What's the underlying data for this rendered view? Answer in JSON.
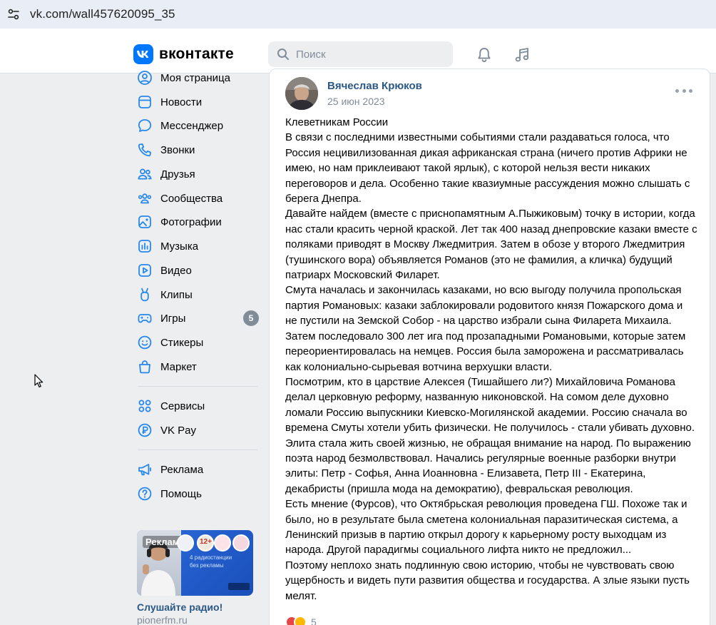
{
  "browser": {
    "url": "vk.com/wall457620095_35"
  },
  "header": {
    "logo_text": "вконтакте",
    "search_placeholder": "Поиск",
    "accent_color": "#0077ff"
  },
  "sidebar": {
    "items": [
      {
        "label": "Моя страница",
        "icon": "user-icon"
      },
      {
        "label": "Новости",
        "icon": "news-icon"
      },
      {
        "label": "Мессенджер",
        "icon": "message-icon"
      },
      {
        "label": "Звонки",
        "icon": "phone-icon"
      },
      {
        "label": "Друзья",
        "icon": "friends-icon"
      },
      {
        "label": "Сообщества",
        "icon": "communities-icon"
      },
      {
        "label": "Фотографии",
        "icon": "photos-icon"
      },
      {
        "label": "Музыка",
        "icon": "music-icon"
      },
      {
        "label": "Видео",
        "icon": "video-icon"
      },
      {
        "label": "Клипы",
        "icon": "clips-icon"
      },
      {
        "label": "Игры",
        "icon": "games-icon",
        "badge": "5"
      },
      {
        "label": "Стикеры",
        "icon": "stickers-icon"
      },
      {
        "label": "Маркет",
        "icon": "market-icon"
      }
    ],
    "secondary": [
      {
        "label": "Сервисы",
        "icon": "services-icon"
      },
      {
        "label": "VK Pay",
        "icon": "vkpay-icon"
      }
    ],
    "tertiary": [
      {
        "label": "Реклама",
        "icon": "megaphone-icon"
      },
      {
        "label": "Помощь",
        "icon": "help-icon"
      }
    ],
    "ad": {
      "label": "Реклама",
      "age": "12+",
      "line1": "4 радиостанции",
      "line2": "без рекламы",
      "title": "Слушайте радио!",
      "domain": "pionerfm.ru"
    }
  },
  "post": {
    "author": "Вячеслав Крюков",
    "date": "25 июн 2023",
    "text": "Клеветникам России\nВ связи с последними известными событиями стали раздаваться голоса, что Россия нецивилизованная дикая африканская страна (ничего против Африки не имею, но нам приклеивают такой ярлык), с которой нельзя вести никаких переговоров и дела. Особенно такие квазиумные рассуждения можно слышать с берега Днепра.\nДавайте найдем (вместе с приснопамятным А.Пыжиковым) точку в истории, когда нас стали красить черной краской. Лет так 400 назад днепровские казаки вместе с поляками приводят в Москву Лжедмитрия. Затем в обозе у второго Лжедмитрия (тушинского вора) объявляется Романов (это не фамилия, а кличка) будущий патриарх Московский Филарет.\nСмута началась и закончилась казаками, но всю выгоду получила пропольская партия Романовых: казаки заблокировали родовитого князя Пожарского дома и не пустили на Земской Собор - на царство избрали сына Филарета Михаила. Затем последовало 300 лет ига под прозападными Романовыми, которые затем переориентировалась на немцев. Россия была заморожена и рассматривалась как колониально-сырьевая вотчина верхушки власти.\nПосмотрим, кто в царствие Алексея (Тишайшего ли?) Михайловича Романова делал церковную реформу, названную никоновской. На сомом деле духовно ломали Россию выпускники Киевско-Могилянской академии. Россию сначала во времена Смуты хотели убить физически. Не получилось - стали убивать духовно. Элита стала жить своей жизнью, не обращая внимание на народ. По выражению поэта народ безмолвствовал. Начались регулярные военные разборки внутри элиты: Петр - Софья, Анна Иоанновна - Елизавета, Петр III - Екатерина, декабристы (пришла мода на демократию), февральская революция.\nЕсть мнение (Фурсов), что Октябрьская революция проведена ГШ. Похоже так и было, но в результате была сметена колониальная паразитическая система, а Ленинский призыв в партию открыл дорогу к карьерному росту выходцам из народа. Другой парадигмы социального лифта никто не предложил...\nПоэтому неплохо знать подлинную свою историю, чтобы не чувствовать свою ущербность и видеть пути развития общества и государства. А злые языки пусть мелят.",
    "reactions_count": "5"
  }
}
